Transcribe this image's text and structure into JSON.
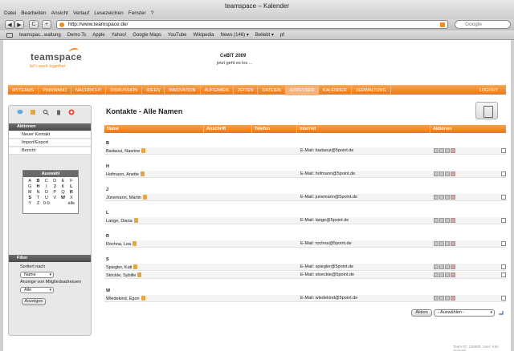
{
  "window": {
    "title": "teamspace – Kalender",
    "menus": [
      "Datei",
      "Bearbeiten",
      "Ansicht",
      "Verlauf",
      "Lesezeichen",
      "Fenster",
      "?"
    ]
  },
  "toolbar": {
    "url": "http://www.teamspace.de/",
    "search_placeholder": "Google",
    "back": "◀",
    "forward": "▶",
    "reload": "C",
    "add": "+"
  },
  "bookmarks": [
    "teamspac...waltung",
    "Demo Ts",
    "Apple",
    "Yahoo!",
    "Google Maps",
    "YouTube",
    "Wikipedia",
    "News (146) ▾",
    "Beliebt ▾",
    "pf"
  ],
  "brand": {
    "logo": "teamspace",
    "tagline": "let's work together",
    "event_title": "CeBIT 2009",
    "event_sub": "jetzt geht es los ...",
    "accent": "#f08c1e"
  },
  "nav": {
    "items": [
      "MYTEAMS",
      "PINNWAND",
      "NACHRICHT",
      "DISKUSSION",
      "IDEEN",
      "INNOVATION",
      "AUFGABEN",
      "ZEITEN",
      "DATEIEN",
      "ADRESSEN",
      "KALENDER",
      "VERWALTUNG"
    ],
    "active": "ADRESSEN",
    "logout": "LOGOUT"
  },
  "sidebar": {
    "aktionen_title": "Aktionen",
    "aktionen": [
      "Neuer Kontakt",
      "Import/Export",
      "Bericht"
    ],
    "auswahl_title": "Auswahl",
    "letters": [
      "A",
      "B",
      "C",
      "D",
      "E",
      "F",
      "G",
      "H",
      "I",
      "J",
      "K",
      "L",
      "M",
      "N",
      "O",
      "P",
      "Q",
      "R",
      "S",
      "T",
      "U",
      "V",
      "W",
      "X",
      "Y",
      "Z",
      "0-9",
      "",
      "",
      "alle"
    ],
    "filter_title": "Filter",
    "sort_label": "Sortiert nach",
    "sort_value": "Name",
    "member_label": "Anzeige von Mitgliedsadressen",
    "member_value": "Alle",
    "show_button": "Anzeigen"
  },
  "main": {
    "title": "Kontakte - Alle Namen",
    "columns": [
      "Name",
      "Anschrift",
      "Telefon",
      "Internet",
      "Aktionen"
    ],
    "groups": [
      {
        "letter": "B",
        "rows": [
          {
            "name": "Badaoui, Nasrine",
            "mail": "E-Mail: badaoui@5point.de"
          }
        ]
      },
      {
        "letter": "H",
        "rows": [
          {
            "name": "Hofmann, Anette",
            "mail": "E-Mail: hofmann@5point.de"
          }
        ]
      },
      {
        "letter": "J",
        "rows": [
          {
            "name": "Jünemann, Martin",
            "mail": "E-Mail: junemann@5point.de"
          }
        ]
      },
      {
        "letter": "L",
        "rows": [
          {
            "name": "Lange, Diana",
            "mail": "E-Mail: lange@5point.de"
          }
        ]
      },
      {
        "letter": "R",
        "rows": [
          {
            "name": "Rochna, Lea",
            "mail": "E-Mail: rochna@5point.de"
          }
        ]
      },
      {
        "letter": "S",
        "rows": [
          {
            "name": "Spiegler, Kati",
            "mail": "E-Mail: spiegler@5point.de"
          },
          {
            "name": "Stöckle, Sybille",
            "mail": "E-Mail: stoeckle@5point.de"
          }
        ]
      },
      {
        "letter": "W",
        "rows": [
          {
            "name": "Wiedekind, Egon",
            "mail": "E-Mail: wiedekind@5point.de"
          }
        ]
      }
    ],
    "action_button": "Aktion",
    "action_select": "- Auswählen -"
  },
  "footer": "Team ID: 126980, User: Kati Spiegler"
}
